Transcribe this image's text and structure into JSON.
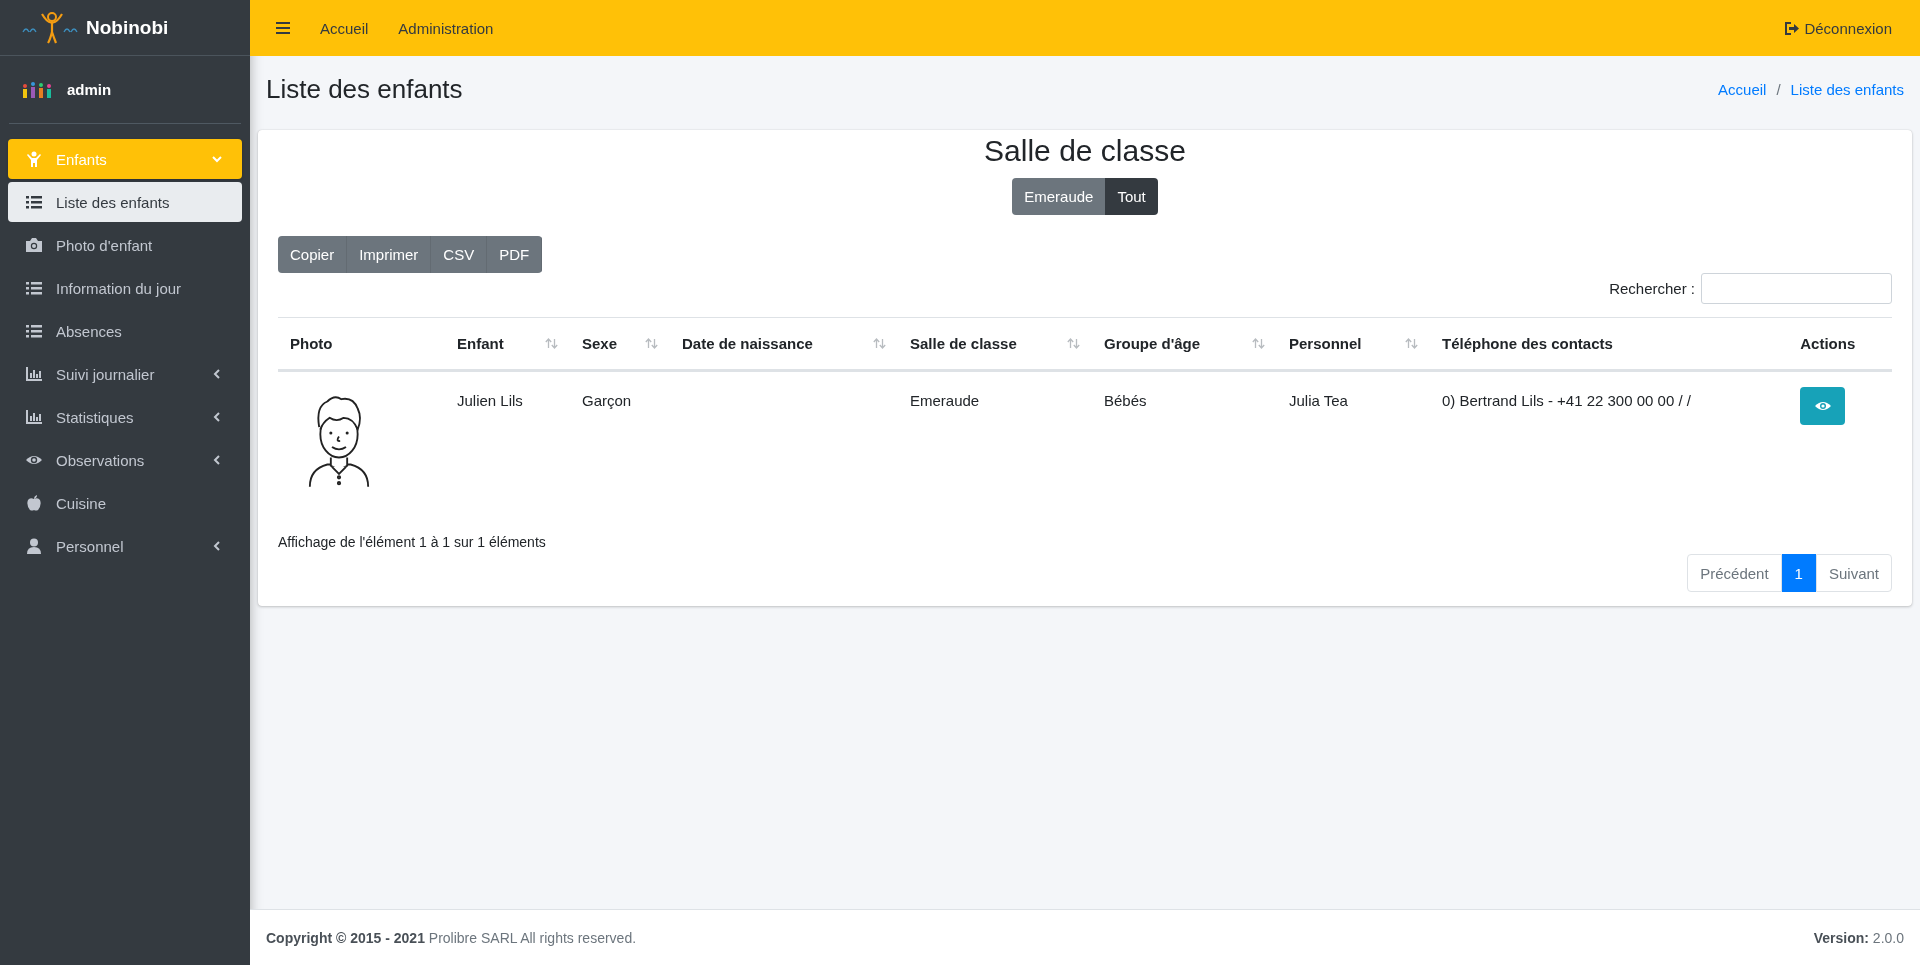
{
  "brand": {
    "name": "Nobinobi"
  },
  "user": {
    "name": "admin"
  },
  "sidebar": {
    "items": [
      {
        "label": "Enfants",
        "selected": true,
        "expanded": true,
        "children": [
          {
            "label": "Liste des enfants",
            "selected": true
          },
          {
            "label": "Photo d'enfant",
            "selected": false
          },
          {
            "label": "Information du jour",
            "selected": false
          },
          {
            "label": "Absences",
            "selected": false
          }
        ]
      },
      {
        "label": "Suivi journalier",
        "selected": false,
        "expanded": false
      },
      {
        "label": "Statistiques",
        "selected": false,
        "expanded": false
      },
      {
        "label": "Observations",
        "selected": false,
        "expanded": false
      },
      {
        "label": "Cuisine",
        "selected": false
      },
      {
        "label": "Personnel",
        "selected": false,
        "expanded": false
      }
    ]
  },
  "topbar": {
    "links": [
      "Accueil",
      "Administration"
    ],
    "logout": "Déconnexion"
  },
  "page": {
    "title": "Liste des enfants",
    "breadcrumb_separator": "/",
    "breadcrumb": [
      "Accueil",
      "Liste des enfants"
    ]
  },
  "card": {
    "title": "Salle de classe",
    "filters": [
      {
        "label": "Emeraude",
        "selected": false
      },
      {
        "label": "Tout",
        "selected": true
      }
    ],
    "export_buttons": [
      "Copier",
      "Imprimer",
      "CSV",
      "PDF"
    ],
    "search": {
      "label": "Rechercher :"
    },
    "table": {
      "columns": [
        {
          "label": "Photo",
          "sortable": false
        },
        {
          "label": "Enfant",
          "sortable": true
        },
        {
          "label": "Sexe",
          "sortable": true
        },
        {
          "label": "Date de naissance",
          "sortable": true
        },
        {
          "label": "Salle de classe",
          "sortable": true
        },
        {
          "label": "Groupe d'âge",
          "sortable": true
        },
        {
          "label": "Personnel",
          "sortable": true
        },
        {
          "label": "Téléphone des contacts",
          "sortable": false
        },
        {
          "label": "Actions",
          "sortable": false
        }
      ],
      "rows": [
        {
          "enfant": "Julien Lils",
          "sexe": "Garçon",
          "salle": "Emeraude",
          "groupe": "Bébés",
          "personnel": "Julia Tea",
          "telephone": "0) Bertrand Lils - +41 22 300 00 00 / /"
        }
      ]
    },
    "info": "Affichage de l'élément 1 à 1 sur 1 éléments",
    "pagination": [
      {
        "label": "Précédent",
        "kind": "prev",
        "selected": false
      },
      {
        "label": "1",
        "kind": "page",
        "selected": true
      },
      {
        "label": "Suivant",
        "kind": "next",
        "selected": false
      }
    ]
  },
  "footer": {
    "copyright": "**Copyright © 2015 - 2021** Prolibre SARL All rights reserved.",
    "version": "**Version:** 2.0.0"
  }
}
